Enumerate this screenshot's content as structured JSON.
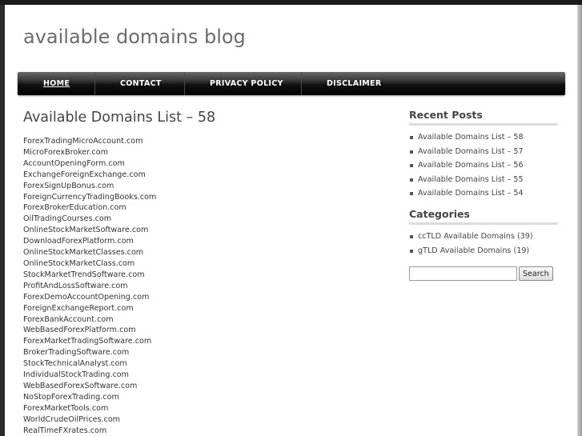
{
  "site": {
    "title": "available domains blog"
  },
  "nav": {
    "items": [
      {
        "label": "HOME",
        "active": true
      },
      {
        "label": "CONTACT",
        "active": false
      },
      {
        "label": "PRIVACY POLICY",
        "active": false
      },
      {
        "label": "DISCLAIMER",
        "active": false
      }
    ]
  },
  "post": {
    "title": "Available Domains List – 58",
    "domains": [
      "ForexTradingMicroAccount.com",
      "MicroForexBroker.com",
      "AccountOpeningForm.com",
      "ExchangeForeignExchange.com",
      "ForexSignUpBonus.com",
      "ForeignCurrencyTradingBooks.com",
      "ForexBrokerEducation.com",
      "OilTradingCourses.com",
      "OnlineStockMarketSoftware.com",
      "DownloadForexPlatform.com",
      "OnlineStockMarketClasses.com",
      "OnlineStockMarketClass.com",
      "StockMarketTrendSoftware.com",
      "ProfitAndLossSoftware.com",
      "ForexDemoAccountOpening.com",
      "ForeignExchangeReport.com",
      "ForexBankAccount.com",
      "WebBasedForexPlatform.com",
      "ForexMarketTradingSoftware.com",
      "BrokerTradingSoftware.com",
      "StockTechnicalAnalyst.com",
      "IndividualStockTrading.com",
      "WebBasedForexSoftware.com",
      "NoStopForexTrading.com",
      "ForexMarketTools.com",
      "WorldCrudeOilPrices.com",
      "RealTimeFXrates.com"
    ]
  },
  "sidebar": {
    "recent_posts": {
      "title": "Recent Posts",
      "items": [
        "Available Domains List – 58",
        "Available Domains List – 57",
        "Available Domains List – 56",
        "Available Domains List – 55",
        "Available Domains List – 54"
      ]
    },
    "categories": {
      "title": "Categories",
      "items": [
        "ccTLD Available Domains (39)",
        "gTLD Available Domains (19)"
      ]
    },
    "search": {
      "value": "",
      "button_label": "Search"
    }
  },
  "colors": {
    "background": "#2b2b2b",
    "page": "#ffffff",
    "title_text": "#6b6b6b",
    "nav_bar": "#111111",
    "nav_text": "#ffffff"
  }
}
